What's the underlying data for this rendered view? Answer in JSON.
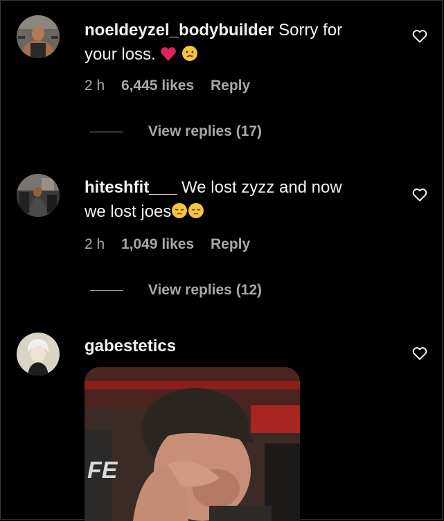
{
  "comments": [
    {
      "username": "noeldeyzel_bodybuilder",
      "text_line1": "Sorry for",
      "text_line2": "your loss.",
      "time": "2 h",
      "likes": "6,445 likes",
      "reply_label": "Reply",
      "view_replies": "View replies (17)"
    },
    {
      "username": "hiteshfit___",
      "text_line1": "We lost zyzz and now",
      "text_line2": "we lost joes",
      "time": "2 h",
      "likes": "1,049 likes",
      "reply_label": "Reply",
      "view_replies": "View replies (12)"
    },
    {
      "username": "gabestetics"
    }
  ],
  "icons": {
    "like": "heart-outline-icon",
    "red_heart": "red-heart-emoji",
    "crying": "crying-face-emoji",
    "pensive": "pensive-face-emoji"
  },
  "colors": {
    "background": "#000000",
    "text": "#f5f5f5",
    "secondary": "#a8a8a8",
    "heart_emoji": "#e0245e"
  }
}
